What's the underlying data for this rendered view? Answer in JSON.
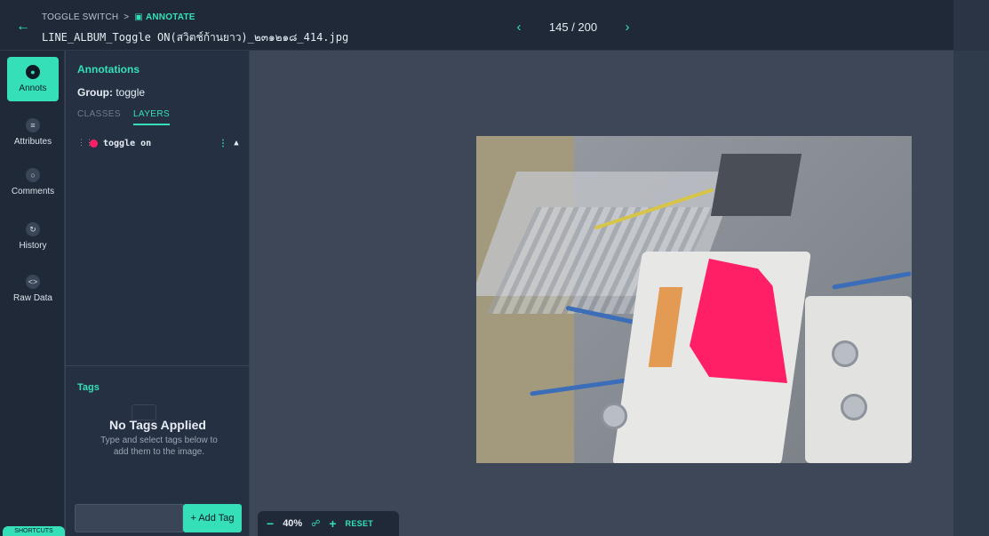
{
  "header": {
    "breadcrumb_parent": "TOGGLE SWITCH",
    "breadcrumb_current": "ANNOTATE",
    "filename": "LINE_ALBUM_Toggle ON(สวิตช์ก้านยาว)_๒๓๑๒๑๘_414.jpg",
    "pager": {
      "current": "145 / 200"
    }
  },
  "rail": {
    "items": [
      {
        "label": "Annots",
        "icon": "annots-icon"
      },
      {
        "label": "Attributes",
        "icon": "attributes-icon"
      },
      {
        "label": "Comments",
        "icon": "comment-icon"
      },
      {
        "label": "History",
        "icon": "history-icon"
      },
      {
        "label": "Raw Data",
        "icon": "code-icon"
      }
    ],
    "shortcuts": "SHORTCUTS"
  },
  "panel": {
    "title": "Annotations",
    "group_label": "Group:",
    "group_value": "toggle",
    "tabs": [
      "CLASSES",
      "LAYERS"
    ],
    "active_tab": "LAYERS",
    "layers": [
      {
        "label": "toggle on",
        "color": "#ff1f66"
      }
    ]
  },
  "tags": {
    "title": "Tags",
    "empty_title": "No Tags Applied",
    "empty_desc": "Type and select tags below to add them to the image.",
    "input_value": "",
    "add_button": "+ Add Tag"
  },
  "zoom": {
    "level": "40%",
    "reset": "RESET"
  },
  "colors": {
    "accent": "#35e0b8",
    "annotation": "#ff1f66",
    "background": "#3b4556"
  }
}
